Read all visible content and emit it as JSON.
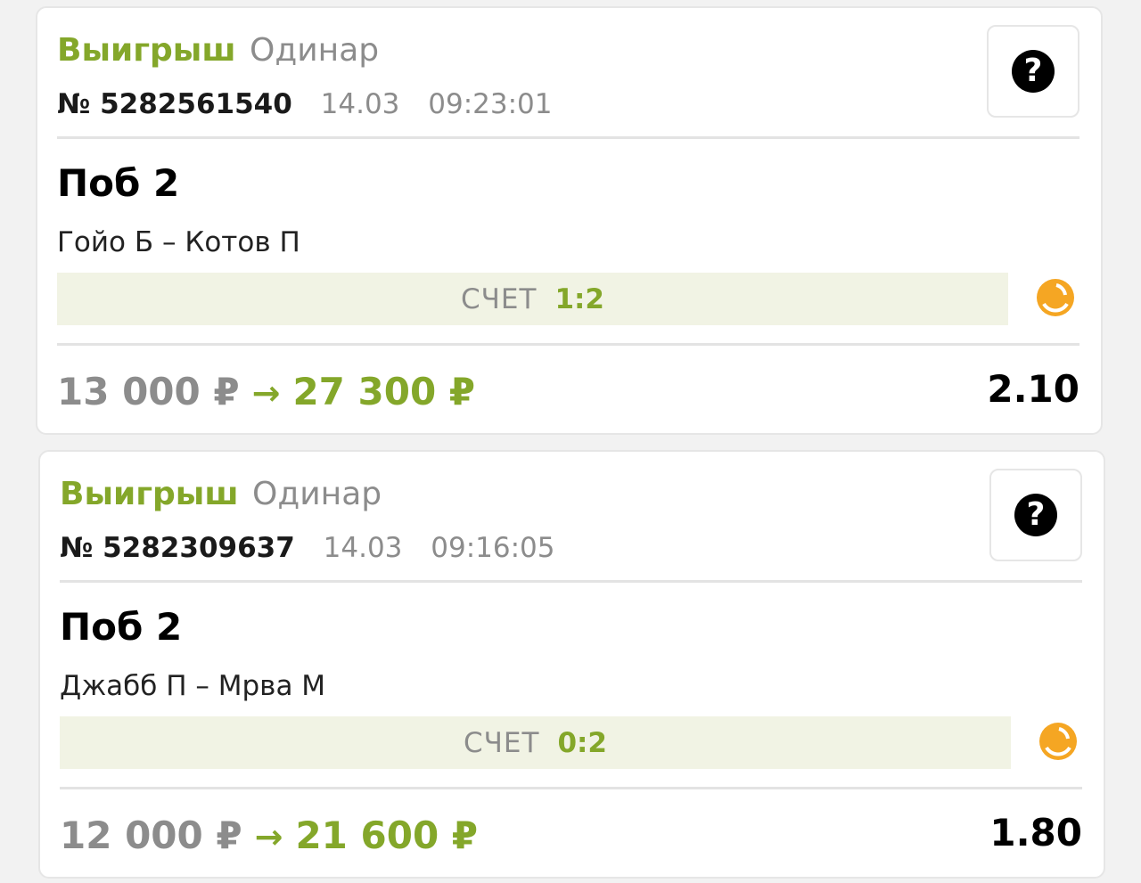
{
  "bets": [
    {
      "status": "Выигрыш",
      "type": "Одинар",
      "number": "№ 5282561540",
      "date": "14.03",
      "time": "09:23:01",
      "help_icon": "?",
      "outcome": "Поб 2",
      "match": "Гойо Б – Котов П",
      "score_label": "СЧЕТ",
      "score_value": "1:2",
      "stake": "13 000 ₽",
      "arrow": "→",
      "payout": "27 300 ₽",
      "coefficient": "2.10"
    },
    {
      "status": "Выигрыш",
      "type": "Одинар",
      "number": "№ 5282309637",
      "date": "14.03",
      "time": "09:16:05",
      "help_icon": "?",
      "outcome": "Поб 2",
      "match": "Джабб П – Мрва М",
      "score_label": "СЧЕТ",
      "score_value": "0:2",
      "stake": "12 000 ₽",
      "arrow": "→",
      "payout": "21 600 ₽",
      "coefficient": "1.80"
    }
  ],
  "colors": {
    "win_green": "#84a72a",
    "muted_grey": "#8c8c8c",
    "score_bg": "#f1f3e4",
    "live_icon_orange": "#f5a623"
  },
  "icons": {
    "help": "question-circle-icon",
    "live": "tennis-ball-icon"
  }
}
